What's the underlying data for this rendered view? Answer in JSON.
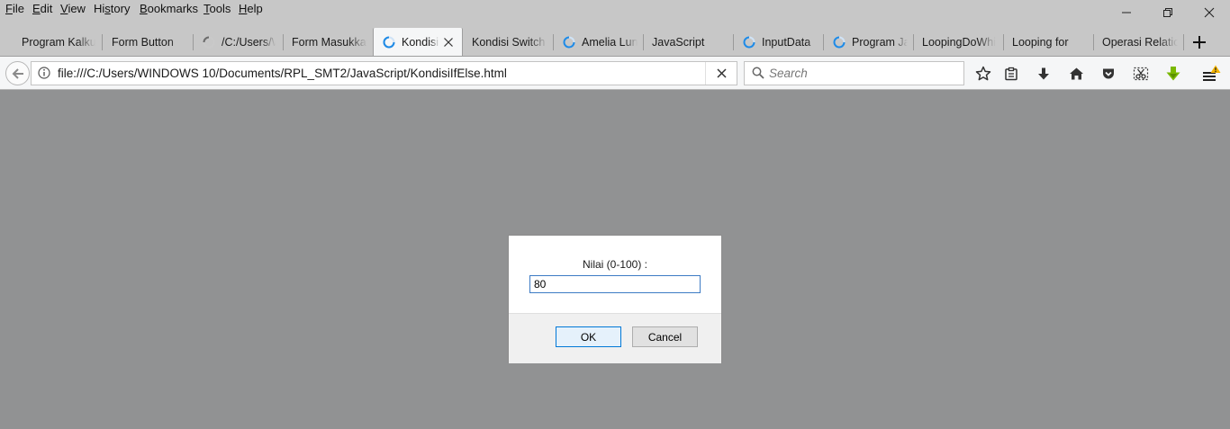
{
  "menubar": {
    "items": [
      {
        "key": "F",
        "rest": "ile"
      },
      {
        "key": "E",
        "rest": "dit"
      },
      {
        "key": "V",
        "rest": "iew"
      },
      {
        "key": "",
        "pre": "Hi",
        "u": "s",
        "post": "tory"
      },
      {
        "key": "B",
        "rest": "ookmarks"
      },
      {
        "key": "T",
        "rest": "ools"
      },
      {
        "key": "H",
        "rest": "elp"
      }
    ],
    "labels": [
      "File",
      "Edit",
      "View",
      "History",
      "Bookmarks",
      "Tools",
      "Help"
    ]
  },
  "tabs": [
    {
      "label": "Program Kalkulator",
      "icon": "none"
    },
    {
      "label": "Form Button",
      "icon": "none"
    },
    {
      "label": "/C:/Users/WINDOWS",
      "icon": "loading-gray-icon"
    },
    {
      "label": "Form Masukkan",
      "icon": "none"
    },
    {
      "label": "Kondisi If Else",
      "icon": "loading-blue-icon",
      "active": true
    },
    {
      "label": "Kondisi Switch",
      "icon": "none"
    },
    {
      "label": "Amelia Lunar",
      "icon": "loading-blue-icon"
    },
    {
      "label": "JavaScript",
      "icon": "none"
    },
    {
      "label": "InputData",
      "icon": "loading-blue-icon"
    },
    {
      "label": "Program Java",
      "icon": "loading-blue-icon"
    },
    {
      "label": "LoopingDoWhile",
      "icon": "none"
    },
    {
      "label": "Looping for",
      "icon": "none"
    },
    {
      "label": "Operasi Relational",
      "icon": "none"
    }
  ],
  "navbar": {
    "url": "file:///C:/Users/WINDOWS 10/Documents/RPL_SMT2/JavaScript/KondisiIfElse.html",
    "search_placeholder": "Search"
  },
  "dialog": {
    "message": "Nilai (0-100) :",
    "input_value": "80",
    "ok_label": "OK",
    "cancel_label": "Cancel"
  },
  "colors": {
    "chrome": "#c7c7c7",
    "toolbar": "#f5f6f7",
    "overlay": "#919293",
    "accent": "#0078d7",
    "download_arrow": "#7ab800",
    "warning": "#f4b400"
  }
}
